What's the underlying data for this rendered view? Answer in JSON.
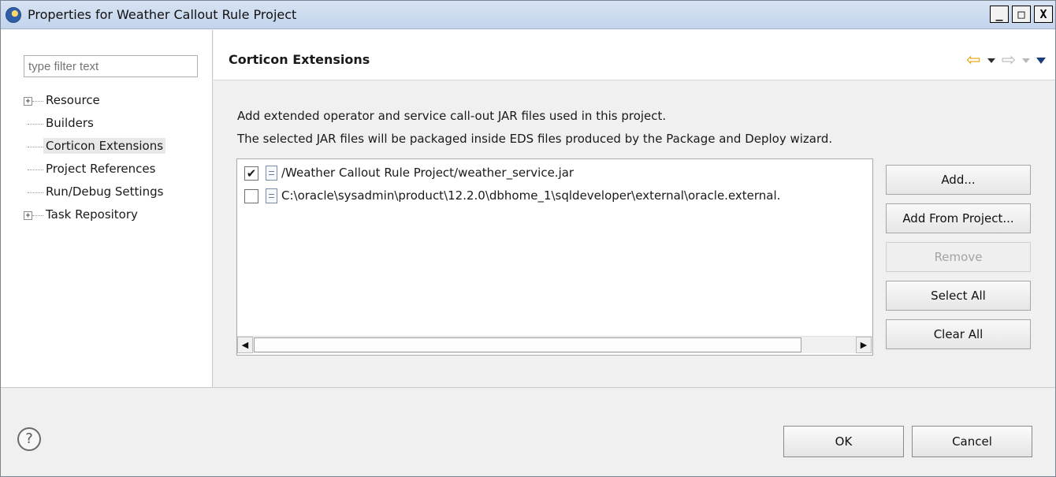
{
  "window": {
    "title": "Properties for Weather Callout Rule Project",
    "controls": {
      "minimize": "_",
      "maximize": "□",
      "close": "X"
    }
  },
  "sidebar": {
    "filter_placeholder": "type filter text",
    "items": [
      {
        "label": "Resource",
        "expandable": true
      },
      {
        "label": "Builders",
        "expandable": false
      },
      {
        "label": "Corticon Extensions",
        "expandable": false,
        "selected": true
      },
      {
        "label": "Project References",
        "expandable": false
      },
      {
        "label": "Run/Debug Settings",
        "expandable": false
      },
      {
        "label": "Task Repository",
        "expandable": true
      }
    ]
  },
  "page": {
    "title": "Corticon Extensions",
    "nav_icons": [
      "back-arrow-icon",
      "back-menu-icon",
      "forward-arrow-icon",
      "forward-menu-icon",
      "view-menu-icon"
    ],
    "description_line1": "Add extended operator and service call-out JAR files used in this project.",
    "description_line2": "The selected JAR files will be packaged inside EDS files produced by the Package and Deploy wizard."
  },
  "jar_list": [
    {
      "checked": true,
      "path": "/Weather Callout Rule Project/weather_service.jar"
    },
    {
      "checked": false,
      "path": "C:\\oracle\\sysadmin\\product\\12.2.0\\dbhome_1\\sqldeveloper\\external\\oracle.external."
    }
  ],
  "buttons": {
    "add": "Add...",
    "add_from_project": "Add From Project...",
    "remove": "Remove",
    "select_all": "Select All",
    "clear_all": "Clear All",
    "ok": "OK",
    "cancel": "Cancel",
    "help": "?"
  },
  "colors": {
    "title_bar": "#c3d4ec",
    "back_arrow": "#e6a400",
    "selection": "#e8e8e8"
  }
}
